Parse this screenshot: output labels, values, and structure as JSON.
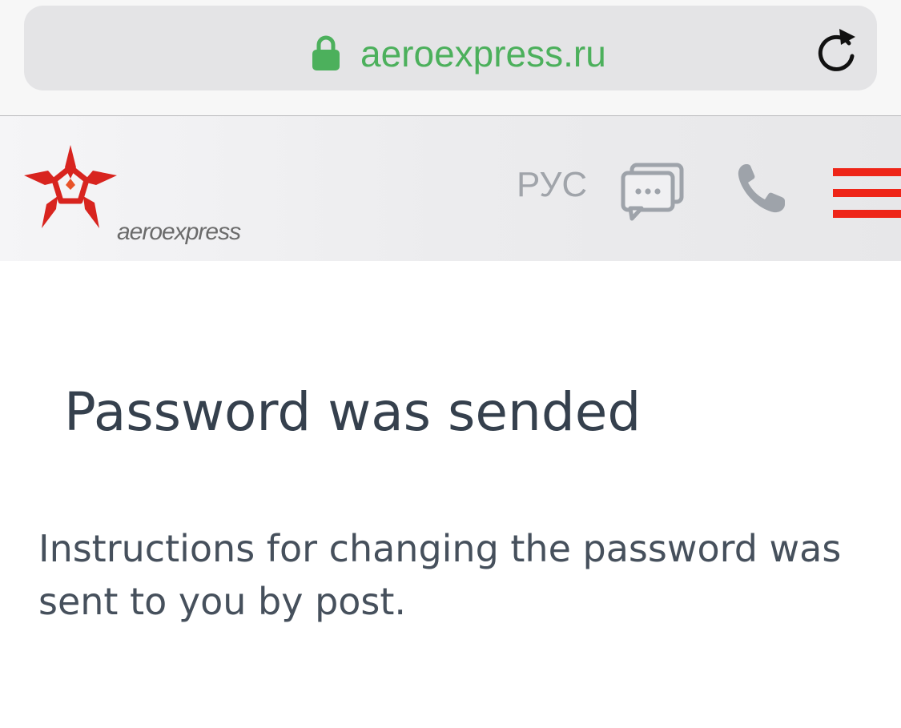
{
  "browser": {
    "url": "aeroexpress.ru",
    "lock_icon": "lock-icon",
    "reload_icon": "reload-icon",
    "url_color": "#4cb05c"
  },
  "header": {
    "logo_text": "aeroexpress",
    "language": "РУС",
    "chat_icon": "chat-bubbles-icon",
    "phone_icon": "phone-icon",
    "menu_icon": "hamburger-menu-icon",
    "accent_color": "#ee2518"
  },
  "main": {
    "title": "Password was sended",
    "message": "Instructions for changing the password was sent to you by post."
  }
}
